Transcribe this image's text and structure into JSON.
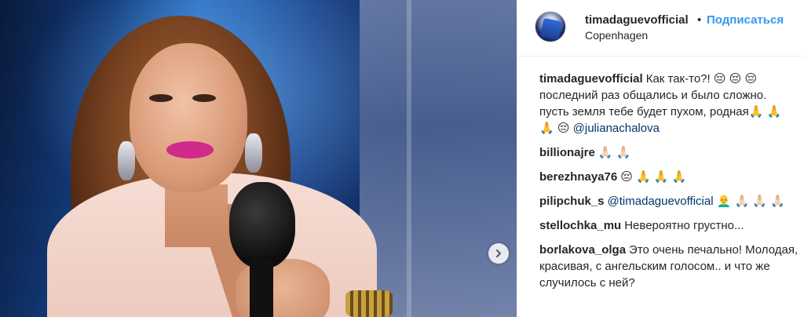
{
  "header": {
    "username": "timadaguevofficial",
    "separator": "•",
    "follow_label": "Подписаться",
    "location": "Copenhagen"
  },
  "icons": {
    "avatar": "avatar-image",
    "next": "chevron-right-icon"
  },
  "colors": {
    "link": "#3897f0",
    "mention": "#003569",
    "text": "#262626"
  },
  "comments": [
    {
      "user": "timadaguevofficial",
      "text": "Как так-то?! 😔 😔 😔 последний раз общались и было сложно. пусть земля тебе будет пухом, родная🙏 🙏 🙏 😔",
      "mention": "@julianachalova"
    },
    {
      "user": "billionajre",
      "text": "🙏🏻 🙏🏻"
    },
    {
      "user": "berezhnaya76",
      "text": "😔 🙏 🙏 🙏"
    },
    {
      "user": "pilipchuk_s",
      "mention": "@timadaguevofficial",
      "text": "👨‍🦲 🙏🏻 🙏🏻 🙏🏻"
    },
    {
      "user": "stellochka_mu",
      "text": "Невероятно грустно..."
    },
    {
      "user": "borlakova_olga",
      "text": "Это очень печально! Молодая, красивая, с ангельским голосом.. и что же случилось с ней?"
    }
  ]
}
